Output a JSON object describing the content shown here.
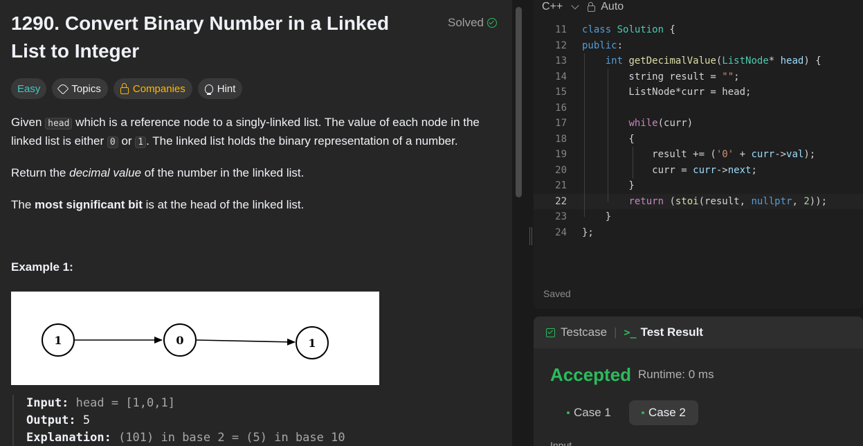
{
  "problem": {
    "title": "1290. Convert Binary Number in a Linked List to Integer",
    "status": "Solved",
    "tags": {
      "difficulty": "Easy",
      "topics": "Topics",
      "companies": "Companies",
      "hint": "Hint"
    },
    "p1": {
      "t1": "Given ",
      "c1": "head",
      "t2": " which is a reference node to a singly-linked list. The value of each node in the linked list is either ",
      "c2": "0",
      "t3": " or ",
      "c3": "1",
      "t4": ". The linked list holds the binary representation of a number."
    },
    "p2": {
      "t1": "Return the ",
      "em": "decimal value",
      "t2": " of the number in the linked list."
    },
    "p3": {
      "t1": "The ",
      "strong": "most significant bit",
      "t2": " is at the head of the linked list."
    },
    "example_title": "Example 1:",
    "diagram_nodes": [
      "1",
      "0",
      "1"
    ],
    "example": {
      "input_label": "Input:",
      "input_value": "head = [1,0,1]",
      "output_label": "Output:",
      "output_value": "5",
      "explanation_label": "Explanation:",
      "explanation_value": "(101) in base 2 = (5) in base 10"
    }
  },
  "editor": {
    "language": "C++",
    "mode": "Auto",
    "saved_label": "Saved",
    "current_line": 22,
    "line_numbers": [
      "11",
      "12",
      "13",
      "14",
      "15",
      "16",
      "17",
      "18",
      "19",
      "20",
      "21",
      "22",
      "23",
      "24"
    ]
  },
  "result": {
    "tab_testcase": "Testcase",
    "tab_result": "Test Result",
    "verdict": "Accepted",
    "runtime": "Runtime: 0 ms",
    "case1": "Case 1",
    "case2": "Case 2",
    "input_label": "Input"
  },
  "colors": {
    "accepted": "#2cbb5d",
    "easy": "#46c6c2",
    "companies": "#ffb800"
  }
}
